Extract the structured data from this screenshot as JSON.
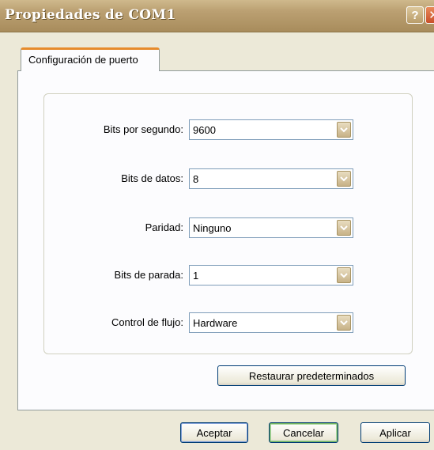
{
  "window": {
    "title": "Propiedades de COM1",
    "help_glyph": "?",
    "close_glyph": "✕"
  },
  "tabs": [
    {
      "label": "Configuración de puerto",
      "selected": true
    }
  ],
  "settings": [
    {
      "label": "Bits por segundo:",
      "value": "9600"
    },
    {
      "label": "Bits de datos:",
      "value": "8"
    },
    {
      "label": "Paridad:",
      "value": "Ninguno"
    },
    {
      "label": "Bits de parada:",
      "value": "1"
    },
    {
      "label": "Control de flujo:",
      "value": "Hardware"
    }
  ],
  "panel": {
    "restore_label": "Restaurar predeterminados"
  },
  "footer": {
    "ok_label": "Aceptar",
    "cancel_label": "Cancelar",
    "apply_label": "Aplicar"
  },
  "icons": {
    "dropdown": "chevron-down-icon",
    "help": "help-icon",
    "close": "close-icon"
  },
  "colors": {
    "titlebar": "#bba072",
    "tab_accent": "#e68b2c",
    "dialog_bg": "#ece9d8",
    "button_border": "#003c74"
  }
}
